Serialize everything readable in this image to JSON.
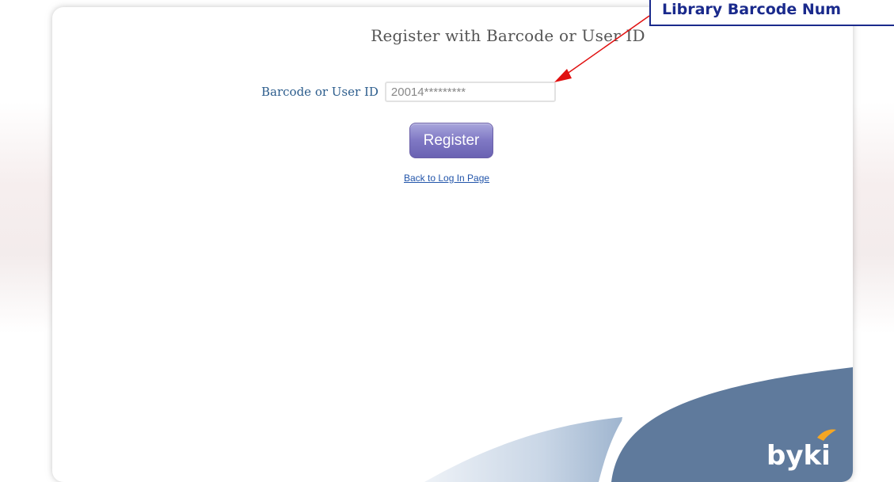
{
  "page": {
    "title": "Register with Barcode or User ID"
  },
  "form": {
    "field_label": "Barcode or User ID",
    "field_value": "20014*********",
    "register_label": "Register",
    "back_link": "Back to Log In Page"
  },
  "annotation": {
    "text": "Library Barcode Num"
  },
  "brand": {
    "logo_text": "byki",
    "accent_color": "#f5a623",
    "swoosh_color": "#5f7a9c"
  },
  "colors": {
    "label_color": "#2b5c8c",
    "button_color": "#7f78c4",
    "annotation_color": "#1a2a8c",
    "arrow_color": "#e01010"
  }
}
